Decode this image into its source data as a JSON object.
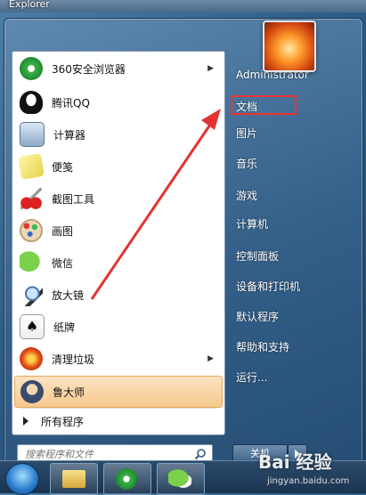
{
  "window_title": "Explorer",
  "programs": [
    {
      "label": "360安全浏览器",
      "icon": "360-browser-icon",
      "has_submenu": true
    },
    {
      "label": "腾讯QQ",
      "icon": "qq-penguin-icon",
      "has_submenu": false
    },
    {
      "label": "计算器",
      "icon": "calculator-icon",
      "has_submenu": false
    },
    {
      "label": "便笺",
      "icon": "sticky-notes-icon",
      "has_submenu": false
    },
    {
      "label": "截图工具",
      "icon": "snipping-tool-icon",
      "has_submenu": false
    },
    {
      "label": "画图",
      "icon": "paint-icon",
      "has_submenu": false
    },
    {
      "label": "微信",
      "icon": "wechat-icon",
      "has_submenu": false
    },
    {
      "label": "放大镜",
      "icon": "magnifier-icon",
      "has_submenu": false
    },
    {
      "label": "纸牌",
      "icon": "solitaire-icon",
      "has_submenu": false
    },
    {
      "label": "清理垃圾",
      "icon": "cleanup-icon",
      "has_submenu": true
    },
    {
      "label": "鲁大师",
      "icon": "ludashi-icon",
      "has_submenu": false,
      "selected": true
    }
  ],
  "all_programs": "所有程序",
  "search_placeholder": "搜索程序和文件",
  "right_items": [
    "Administrator",
    "文档",
    "图片",
    "音乐",
    "游戏",
    "计算机",
    "控制面板",
    "设备和打印机",
    "默认程序",
    "帮助和支持",
    "运行..."
  ],
  "highlighted_item": "文档",
  "shutdown_label": "关机",
  "watermark": "Bai 经验",
  "watermark_url": "jingyan.baidu.com",
  "colors": {
    "highlight_box": "#e33333",
    "annotation_arrow": "#e33333"
  }
}
